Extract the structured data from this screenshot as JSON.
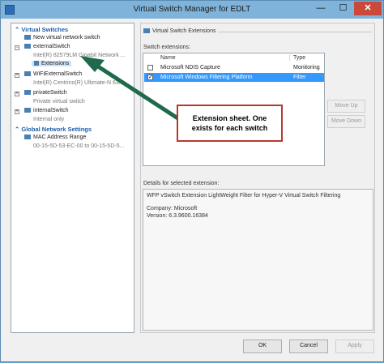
{
  "window": {
    "title": "Virtual Switch Manager for EDLT",
    "close_glyph": "✕",
    "min_glyph": "—",
    "max_glyph": "☐"
  },
  "tree": {
    "virtual_switches_header": "Virtual Switches",
    "new_switch": "New virtual network switch",
    "external_switch": "externalSwitch",
    "external_switch_sub": "Intel(R) 82579LM Gigabit Network ...",
    "extensions": "Extensions",
    "wifi_switch": "WiFiExternalSwitch",
    "wifi_switch_sub": "Intel(R) Centrino(R) Ultimate-N 63...",
    "private_switch": "privateSwitch",
    "private_switch_sub": "Private virtual switch",
    "internal_switch": "internalSwitch",
    "internal_switch_sub": "Internal only",
    "global_header": "Global Network Settings",
    "mac_range": "MAC Address Range",
    "mac_range_sub": "00-15-5D-53-EC-00 to 00-15-5D-5..."
  },
  "panel": {
    "heading": "Virtual Switch Extensions",
    "extensions_label": "Switch extensions:",
    "col_name": "Name",
    "col_type": "Type",
    "rows": [
      {
        "name": "Microsoft NDIS Capture",
        "type": "Monitoring",
        "checked": false
      },
      {
        "name": "Microsoft Windows Filtering Platform",
        "type": "Filter",
        "checked": true
      }
    ],
    "move_up": "Move Up",
    "move_down": "Move Down",
    "details_label": "Details for selected extension:",
    "details_line1": "WFP vSwitch Extension LightWeight Filter for Hyper-V Virtual Switch Filtering",
    "details_company": "Company: Microsoft",
    "details_version": "Version: 6.3.9600.16384"
  },
  "callout": {
    "line1": "Extension sheet. One",
    "line2": "exists for each switch"
  },
  "buttons": {
    "ok": "OK",
    "cancel": "Cancel",
    "apply": "Apply"
  },
  "colors": {
    "accent": "#1e5fa8",
    "selection": "#3399ff",
    "callout_border": "#b53a2e",
    "arrow": "#1f6a4a"
  }
}
